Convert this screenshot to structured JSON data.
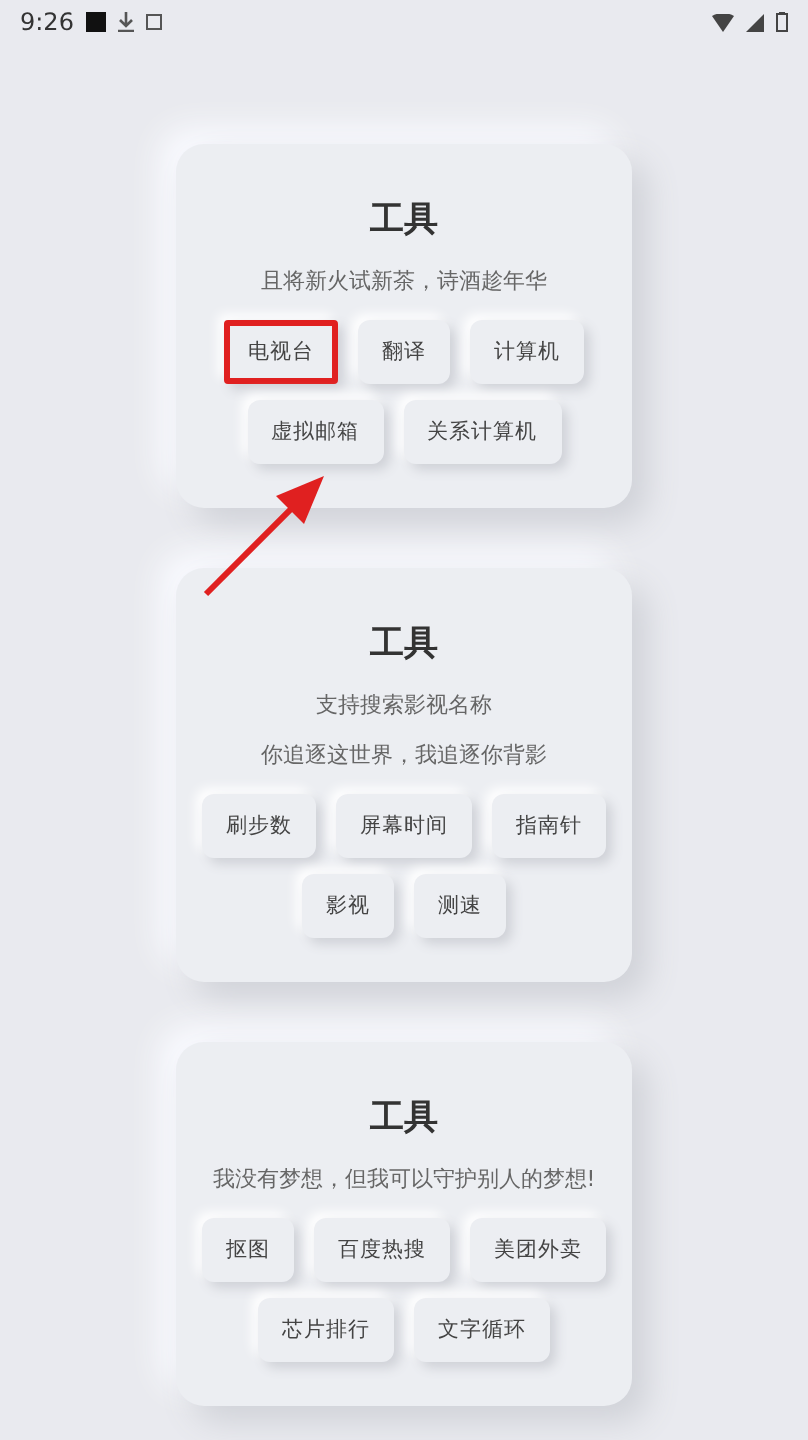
{
  "status_bar": {
    "time": "9:26"
  },
  "cards": [
    {
      "title": "工具",
      "lines": [
        "且将新火试新茶，诗酒趁年华"
      ],
      "tools": [
        {
          "label": "电视台",
          "highlighted": true
        },
        {
          "label": "翻译",
          "highlighted": false
        },
        {
          "label": "计算机",
          "highlighted": false
        },
        {
          "label": "虚拟邮箱",
          "highlighted": false
        },
        {
          "label": "关系计算机",
          "highlighted": false
        }
      ]
    },
    {
      "title": "工具",
      "lines": [
        "支持搜索影视名称",
        "你追逐这世界，我追逐你背影"
      ],
      "tools": [
        {
          "label": "刷步数",
          "highlighted": false
        },
        {
          "label": "屏幕时间",
          "highlighted": false
        },
        {
          "label": "指南针",
          "highlighted": false
        },
        {
          "label": "影视",
          "highlighted": false
        },
        {
          "label": "测速",
          "highlighted": false
        }
      ]
    },
    {
      "title": "工具",
      "lines": [
        "我没有梦想，但我可以守护别人的梦想!"
      ],
      "tools": [
        {
          "label": "抠图",
          "highlighted": false
        },
        {
          "label": "百度热搜",
          "highlighted": false
        },
        {
          "label": "美团外卖",
          "highlighted": false
        },
        {
          "label": "芯片排行",
          "highlighted": false
        },
        {
          "label": "文字循环",
          "highlighted": false
        }
      ]
    }
  ]
}
